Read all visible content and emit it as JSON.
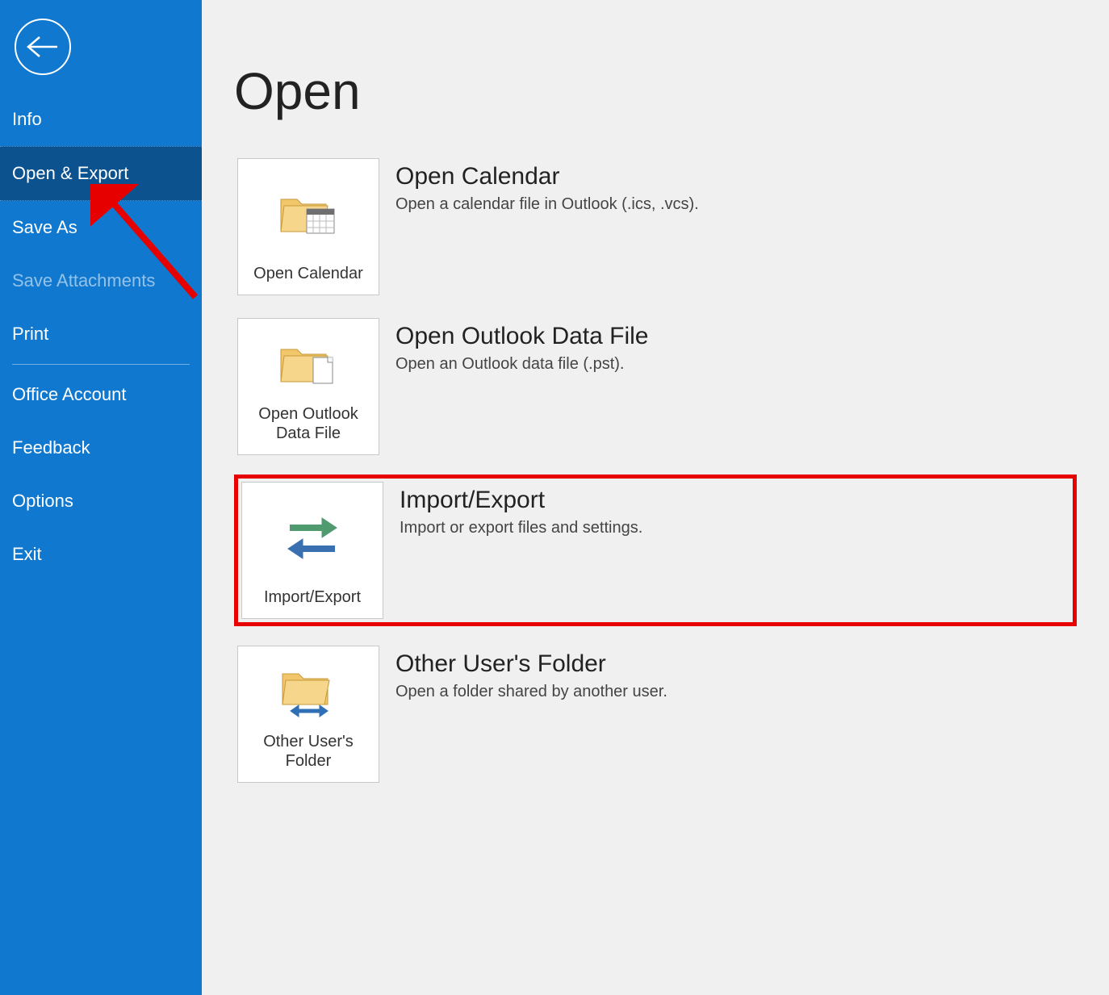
{
  "sidebar": {
    "items": [
      {
        "label": "Info",
        "state": "normal"
      },
      {
        "label": "Open & Export",
        "state": "selected"
      },
      {
        "label": "Save As",
        "state": "normal"
      },
      {
        "label": "Save Attachments",
        "state": "disabled"
      },
      {
        "label": "Print",
        "state": "normal"
      },
      {
        "label": "Office Account",
        "state": "normal"
      },
      {
        "label": "Feedback",
        "state": "normal"
      },
      {
        "label": "Options",
        "state": "normal"
      },
      {
        "label": "Exit",
        "state": "normal"
      }
    ]
  },
  "page": {
    "title": "Open",
    "options": [
      {
        "button_label": "Open Calendar",
        "title": "Open Calendar",
        "desc": "Open a calendar file in Outlook (.ics, .vcs).",
        "icon": "calendar-folder-icon"
      },
      {
        "button_label": "Open Outlook Data File",
        "title": "Open Outlook Data File",
        "desc": "Open an Outlook data file (.pst).",
        "icon": "datafile-folder-icon"
      },
      {
        "button_label": "Import/Export",
        "title": "Import/Export",
        "desc": "Import or export files and settings.",
        "icon": "import-export-icon",
        "highlighted": true
      },
      {
        "button_label": "Other User's Folder",
        "title": "Other User's Folder",
        "desc": "Open a folder shared by another user.",
        "icon": "shared-folder-icon"
      }
    ]
  },
  "annotations": {
    "arrow_target": "Open & Export",
    "box_target": "Import/Export"
  }
}
